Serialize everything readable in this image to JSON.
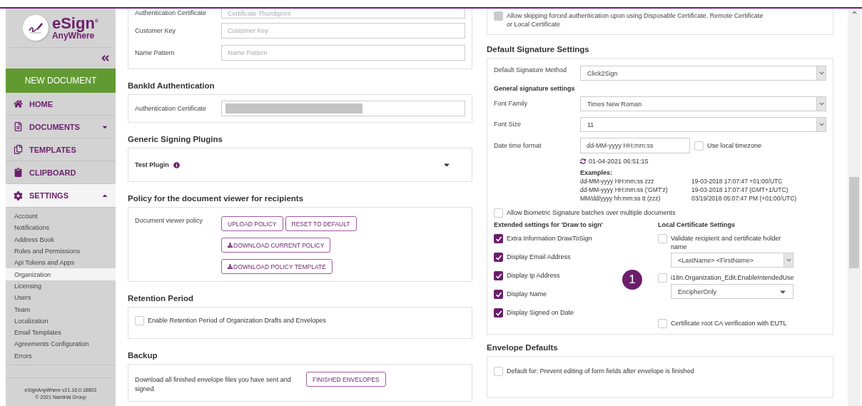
{
  "sidebar": {
    "logo": {
      "title": "eSign$^{®}$",
      "subtitle": "AnyWhere"
    },
    "new_document": "NEW DOCUMENT",
    "nav": [
      {
        "label": "HOME",
        "kind": "link",
        "selected": false
      },
      {
        "label": "DOCUMENTS",
        "kind": "menu",
        "expanded": false,
        "selected": false
      },
      {
        "label": "TEMPLATES",
        "kind": "link",
        "selected": false
      },
      {
        "label": "CLIPBOARD",
        "kind": "link",
        "selected": false
      },
      {
        "label": "SETTINGS",
        "kind": "menu",
        "expanded": true,
        "selected": true
      }
    ],
    "settings_items": [
      {
        "label": "Account",
        "selected": false
      },
      {
        "label": "Notifications",
        "selected": false
      },
      {
        "label": "Address Book",
        "selected": false
      },
      {
        "label": "Roles and Permissions",
        "selected": false
      },
      {
        "label": "Api Tokens and Apps",
        "selected": false
      },
      {
        "label": "Organization",
        "selected": true
      },
      {
        "label": "Licensing",
        "selected": false
      },
      {
        "label": "Users",
        "selected": false
      },
      {
        "label": "Team",
        "selected": false
      },
      {
        "label": "Localization",
        "selected": false
      },
      {
        "label": "Email Templates",
        "selected": false
      },
      {
        "label": "Agreements Configuration",
        "selected": false
      },
      {
        "label": "Errors",
        "selected": false
      }
    ],
    "footer": [
      "eSignAnyWhere v21.16.0.18802",
      "© 2021 Namirial Group"
    ]
  },
  "left": {
    "top_card": {
      "rows": [
        {
          "label": "Authentication Certificate",
          "placeholder": "Certificate Thumbprint"
        },
        {
          "label": "Customer Key",
          "placeholder": "Customer Key"
        },
        {
          "label": "Name Pattern",
          "placeholder": "Name Pattern"
        }
      ]
    },
    "bankid": {
      "title": "BankId Authentication",
      "label": "Authentication Certificate",
      "redacted": true
    },
    "plugins": {
      "title": "Generic Signing Plugins",
      "name": "Test Plugin",
      "expanded": false
    },
    "policy": {
      "title": "Policy for the document viewer for recipients",
      "label": "Document viewer policy",
      "buttons": [
        {
          "label": "UPLOAD POLICY",
          "kind": "plain"
        },
        {
          "label": "RESET TO DEFAULT",
          "kind": "plain"
        },
        {
          "label": "DOWNLOAD CURRENT POLICY",
          "kind": "download"
        },
        {
          "label": "DOWNLOAD POLICY TEMPLATE",
          "kind": "download"
        }
      ]
    },
    "retention": {
      "title": "Retention Period",
      "checkbox": {
        "label": "Enable Retention Period of Organization Drafts and Envelopes",
        "checked": false
      }
    },
    "backup": {
      "title": "Backup",
      "text": "Download all finished envelope files you have sent and signed.",
      "button": "FINISHED ENVELOPES"
    }
  },
  "right": {
    "top_card": {
      "checkbox": {
        "label": "Allow skipping forced authentication upon using Disposable Certificate, Remote Certificate or Local Certificate",
        "checked": false,
        "disabled": true
      }
    },
    "signature": {
      "title": "Default Signature Settings",
      "method": {
        "label": "Default Signature Method",
        "value": "Click2Sign"
      },
      "subtitle": "General signature settings",
      "font_family": {
        "label": "Font Family",
        "value": "Times New Roman"
      },
      "font_size": {
        "label": "Font Size",
        "value": "11"
      },
      "date_format": {
        "label": "Date time format",
        "value": "dd-MM-yyyy HH:mm:ss",
        "local": {
          "label": "Use local timezone",
          "checked": false
        }
      },
      "preview": "01-04-2021 06:51:15",
      "examples_title": "Examples:",
      "examples": [
        [
          "dd-MM-yyyy HH:mm:ss zzz",
          "19-03-2018 17:07:47 +01:00/UTC"
        ],
        [
          "dd-MM-yyyy HH:mm:ss ('GMT'z)",
          "19-03-2018 17:07:47 (GMT+1/UTC)"
        ],
        [
          "MM/dd/yyyy hh:mm:ss tt (zzz)",
          "03/19/2018 05:07:47 PM (+01:00/UTC)"
        ]
      ],
      "biometric": {
        "label": "Allow Biometric Signature batches over multiple documents",
        "checked": false
      },
      "draw_title": "Extended settings for 'Draw to sign'",
      "draw_options": [
        {
          "label": "Extra Information DrawToSign",
          "checked": true
        },
        {
          "label": "Display Email Address",
          "checked": true
        },
        {
          "label": "Display Ip Address",
          "checked": true
        },
        {
          "label": "Display Name",
          "checked": true
        },
        {
          "label": "Display Signed on Date",
          "checked": true
        }
      ],
      "local_title": "Local Certificate Settings",
      "local_options": [
        {
          "label": "Validate recipient and certificate holder name",
          "checked": false,
          "select": {
            "value": "<LastName> <FirstName>",
            "kind": "boxed"
          }
        },
        {
          "label": "i18n.Organization_Edit.EnableIntendedUse",
          "checked": false,
          "select": {
            "value": "EncipherOnly",
            "kind": "triangle"
          }
        },
        {
          "label": "Certificate root CA verification with EUTL",
          "checked": false
        }
      ],
      "callout": "1"
    },
    "envelope": {
      "title": "Envelope Defaults",
      "checkbox": {
        "label": "Default for: Prevent editing of form fields after envelope is finished",
        "checked": false
      }
    }
  }
}
